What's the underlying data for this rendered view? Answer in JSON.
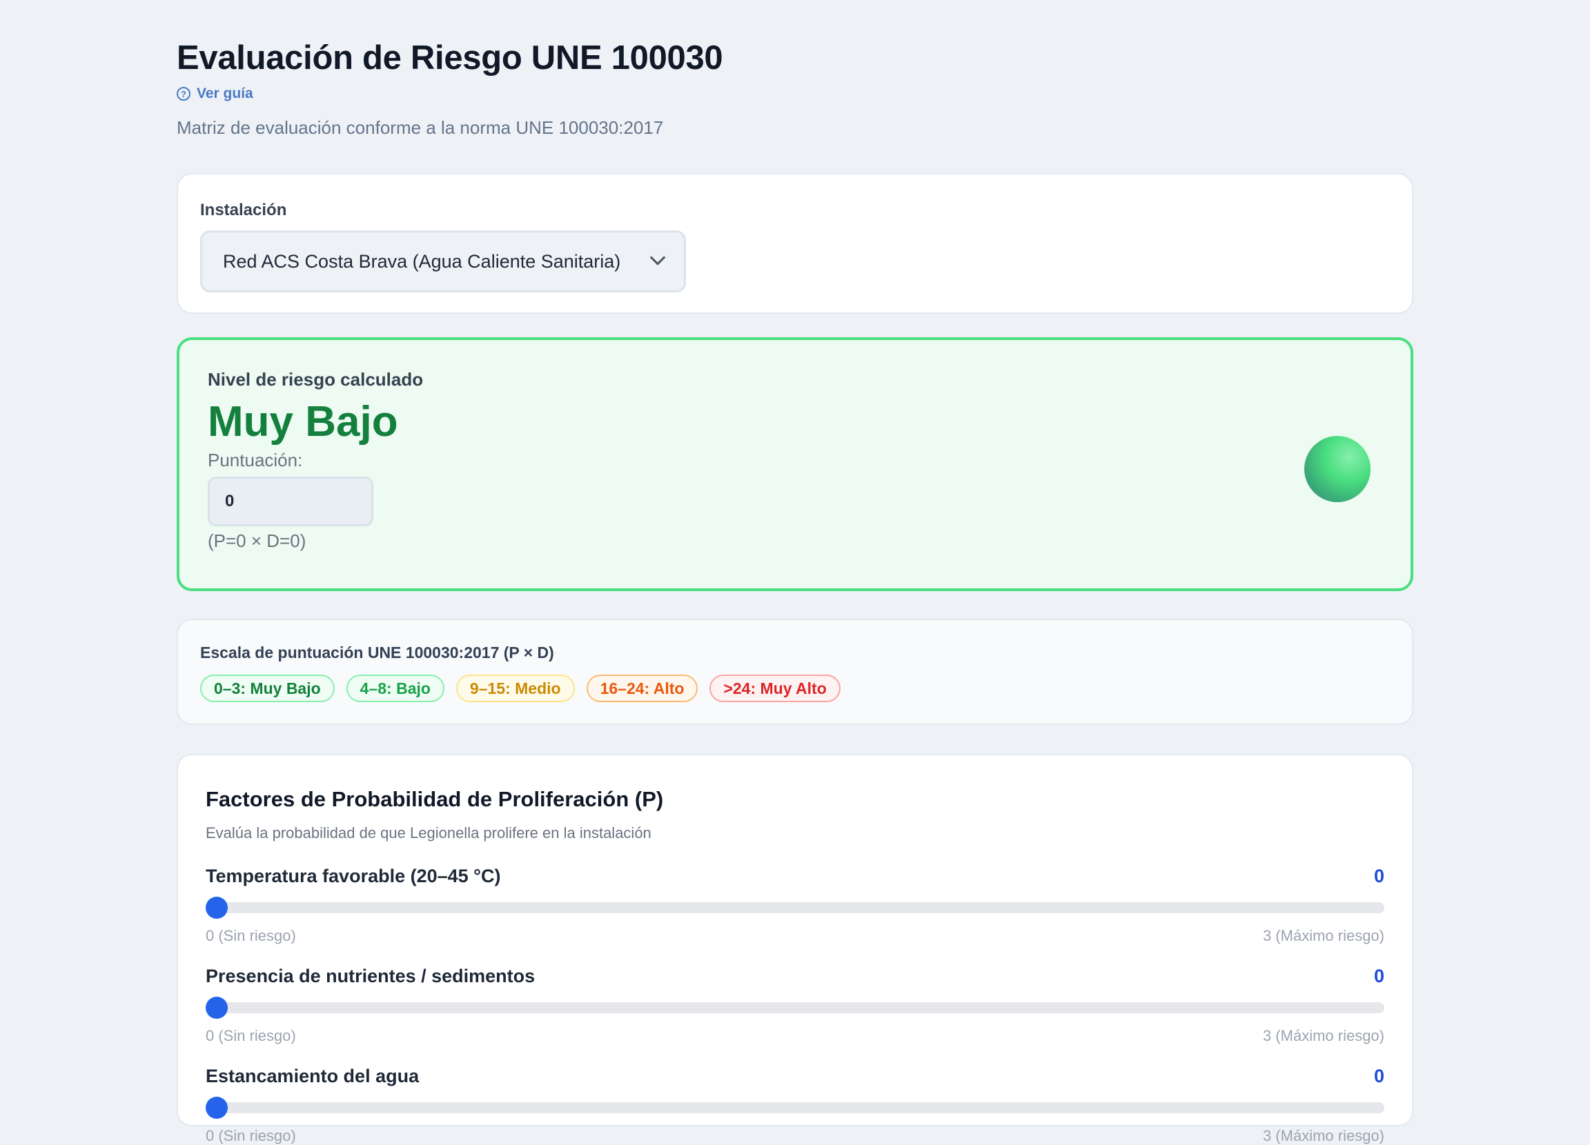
{
  "header": {
    "title": "Evaluación de Riesgo UNE 100030",
    "guide_link": "Ver guía",
    "subtitle": "Matriz de evaluación conforme a la norma UNE 100030:2017"
  },
  "installation": {
    "label": "Instalación",
    "selected": "Red ACS Costa Brava (Agua Caliente Sanitaria)"
  },
  "risk": {
    "label": "Nivel de riesgo calculado",
    "level": "Muy Bajo",
    "score_label": "Puntuación:",
    "score_value": "0",
    "formula": "(P=0 × D=0)",
    "accent_color": "#15803d",
    "border_color": "#4ade80"
  },
  "scale": {
    "title": "Escala de puntuación UNE 100030:2017 (P × D)",
    "items": [
      "0–3: Muy Bajo",
      "4–8: Bajo",
      "9–15: Medio",
      "16–24: Alto",
      ">24: Muy Alto"
    ]
  },
  "probability": {
    "title": "Factores de Probabilidad de Proliferación (P)",
    "description": "Evalúa la probabilidad de que Legionella prolifere en la instalación",
    "factors": [
      {
        "name": "Temperatura favorable (20–45 °C)",
        "value": "0",
        "level": 0,
        "max": 3,
        "min_label": "0 (Sin riesgo)",
        "max_label": "3 (Máximo riesgo)"
      },
      {
        "name": "Presencia de nutrientes / sedimentos",
        "value": "0",
        "level": 0,
        "max": 3,
        "min_label": "0 (Sin riesgo)",
        "max_label": "3 (Máximo riesgo)"
      },
      {
        "name": "Estancamiento del agua",
        "value": "0",
        "level": 0,
        "max": 3,
        "min_label": "0 (Sin riesgo)",
        "max_label": "3 (Máximo riesgo)"
      }
    ]
  }
}
